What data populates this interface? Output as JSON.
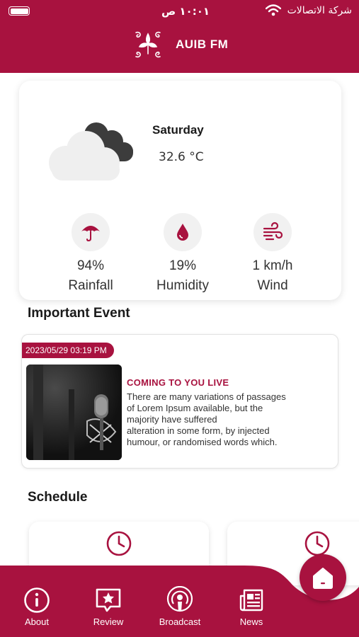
{
  "status_bar": {
    "time": "١٠:٠١ ص",
    "carrier": "شركة الاتصالات"
  },
  "header": {
    "title": "AUIB FM"
  },
  "weather": {
    "day": "Saturday",
    "temperature": "32.6 °C",
    "stats": [
      {
        "value": "94%",
        "label": "Rainfall",
        "icon": "umbrella-icon"
      },
      {
        "value": "19%",
        "label": "Humidity",
        "icon": "droplet-icon"
      },
      {
        "value": "1 km/h",
        "label": "Wind",
        "icon": "wind-icon"
      }
    ]
  },
  "important_event": {
    "section_title": "Important Event",
    "date": "2023/05/29 03:19 PM",
    "title": "COMING TO YOU LIVE",
    "body": [
      "There are many variations of passages",
      "of Lorem Ipsum available, but the",
      "majority have suffered",
      "alteration in some form, by injected",
      "humour, or randomised words which."
    ]
  },
  "schedule": {
    "section_title": "Schedule"
  },
  "nav": {
    "items": [
      {
        "label": "About",
        "icon": "info-icon"
      },
      {
        "label": "Review",
        "icon": "review-icon"
      },
      {
        "label": "Broadcast",
        "icon": "podcast-icon"
      },
      {
        "label": "News",
        "icon": "newspaper-icon"
      }
    ],
    "home_icon": "home-icon"
  },
  "colors": {
    "brand": "#a8123f",
    "card_bg": "#ffffff",
    "icon_bg": "#f1f1f1"
  }
}
